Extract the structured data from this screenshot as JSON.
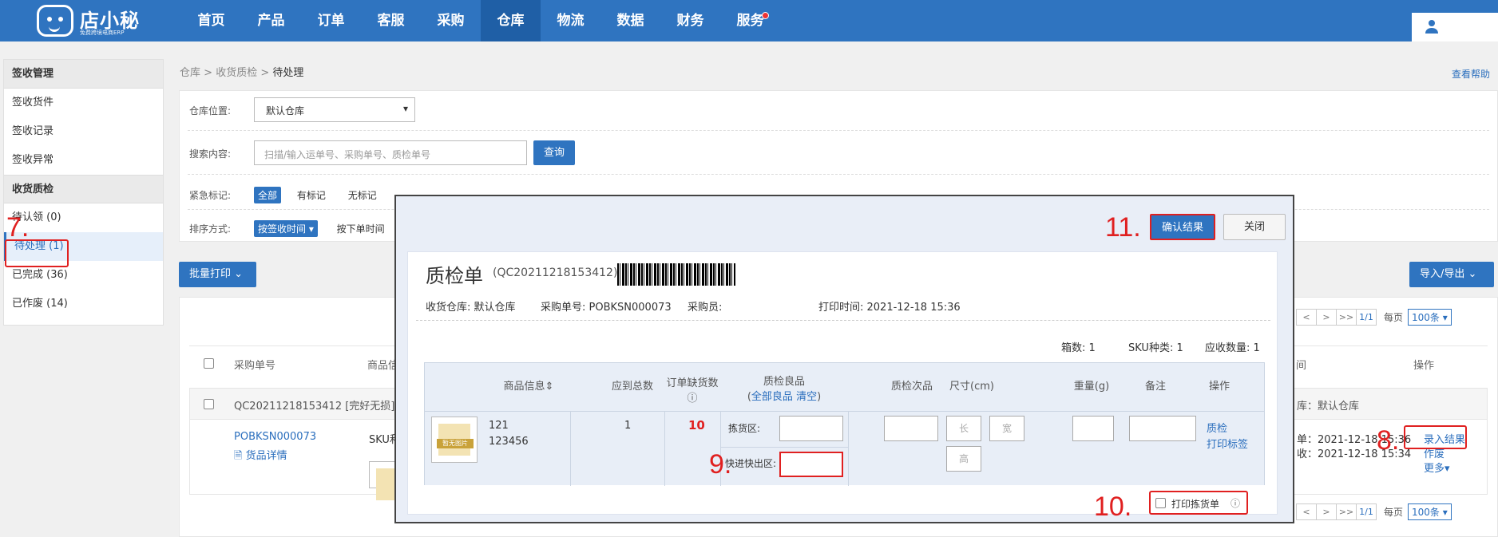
{
  "brand": {
    "name": "店小秘",
    "tagline": "免费跨境电商ERP"
  },
  "nav": [
    {
      "label": "首页"
    },
    {
      "label": "产品"
    },
    {
      "label": "订单"
    },
    {
      "label": "客服"
    },
    {
      "label": "采购"
    },
    {
      "label": "仓库"
    },
    {
      "label": "物流"
    },
    {
      "label": "数据"
    },
    {
      "label": "财务"
    },
    {
      "label": "服务"
    }
  ],
  "sidebar": {
    "sec1": "签收管理",
    "sec1_items": [
      "签收货件",
      "签收记录",
      "签收异常"
    ],
    "sec2": "收货质检",
    "sec2_items": [
      "待认领 (0)",
      "待处理 (1)",
      "已完成 (36)",
      "已作废 (14)"
    ]
  },
  "breadcrumb": {
    "p1": "仓库",
    "p2": "收货质检",
    "current": "待处理",
    "sep": " > "
  },
  "help": "查看帮助",
  "filter": {
    "warehouse_label": "仓库位置:",
    "warehouse_value": "默认仓库",
    "search_label": "搜索内容:",
    "search_placeholder": "扫描/输入运单号、采购单号、质检单号",
    "query_btn": "查询",
    "urgent_label": "紧急标记:",
    "urgent_opts": [
      "全部",
      "有标记",
      "无标记"
    ],
    "sort_label": "排序方式:",
    "sort_opts": [
      "按签收时间 ▾",
      "按下单时间"
    ]
  },
  "batch_print": "批量打印",
  "import_export": "导入/导出",
  "table": {
    "col_po": "采购单号",
    "col_product": "商品信",
    "col_time": "间",
    "col_ops": "操作",
    "qc_line": "QC20211218153412  [完好无损]",
    "po": "POBKSN000073",
    "detail": "货品详情",
    "sku_prefix": "SKU和",
    "right_wh": "库：默认仓库",
    "t1": "单：2021-12-18 15:36",
    "t2": "收：2021-12-18 15:34",
    "op_enter": "录入结果",
    "op_void": "作废",
    "op_more": "更多▾"
  },
  "pager": {
    "first": "<<",
    "prev": "<",
    "next": ">",
    "last": ">>",
    "page": "1/1",
    "per_label": "每页",
    "per": "100条 ▾"
  },
  "modal": {
    "confirm": "确认结果",
    "close": "关闭",
    "title": "质检单",
    "code": "(QC20211218153412)",
    "wh": "收货仓库:  默认仓库",
    "po": "采购单号:  POBKSN000073",
    "buyer": "采购员:",
    "print_time": "打印时间:  2021-12-18 15:36",
    "stats": {
      "boxes": "箱数:  1",
      "sku": "SKU种类:  1",
      "qty": "应收数量:  1"
    },
    "cols": {
      "info": "商品信息",
      "due": "应到总数",
      "short": "订单缺货数",
      "good": "质检良品",
      "good_all": "全部良品",
      "good_clear": "清空",
      "bad": "质检次品",
      "size": "尺寸(cm)",
      "weight": "重量(g)",
      "remark": "备注",
      "ops": "操作"
    },
    "row": {
      "sku": "121",
      "code": "123456",
      "due": "1",
      "short": "10",
      "pick": "拣货区:",
      "fast": "快进快出区:",
      "len": "长",
      "wid": "宽",
      "hei": "高",
      "op1": "质检",
      "op2": "打印标签",
      "nophoto": "暂无图片"
    },
    "print_pick": "打印拣货单"
  },
  "annotations": {
    "a7": "7.",
    "a8": "8.",
    "a9": "9.",
    "a10": "10.",
    "a11": "11."
  }
}
